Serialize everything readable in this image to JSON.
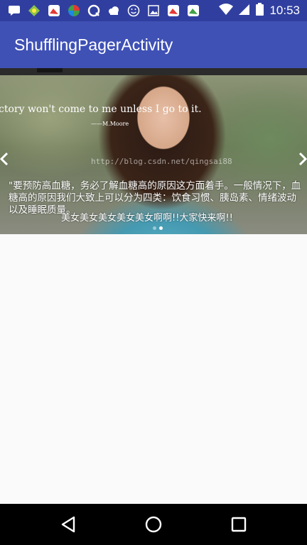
{
  "status_bar": {
    "time": "10:53",
    "left_icons": [
      "chat-icon",
      "app-icon",
      "app-icon",
      "app-icon",
      "q-icon",
      "cloud-icon",
      "smiley-icon",
      "image-icon",
      "app-icon",
      "app-icon"
    ],
    "right_icons": [
      "wifi-icon",
      "signal-icon",
      "battery-icon"
    ]
  },
  "app_bar": {
    "title": "ShufflingPagerActivity"
  },
  "carousel": {
    "image_quote": "ctory won't come to me unless I go to it.",
    "image_quote_author": "——M.Moore",
    "watermark": "http://blog.csdn.net/qingsai88",
    "description": "\"要预防高血糖，务必了解血糖高的原因这方面着手。一般情况下，血糖高的原因我们大致上可以分为四类：饮食习惯、胰岛素、情绪波动以及睡眠质量。",
    "caption": "美女美女美女美女美女啊啊!!大家快来啊!!",
    "page_count": 2,
    "current_page": 2
  },
  "nav_bar": {
    "buttons": [
      "back",
      "home",
      "recents"
    ]
  }
}
